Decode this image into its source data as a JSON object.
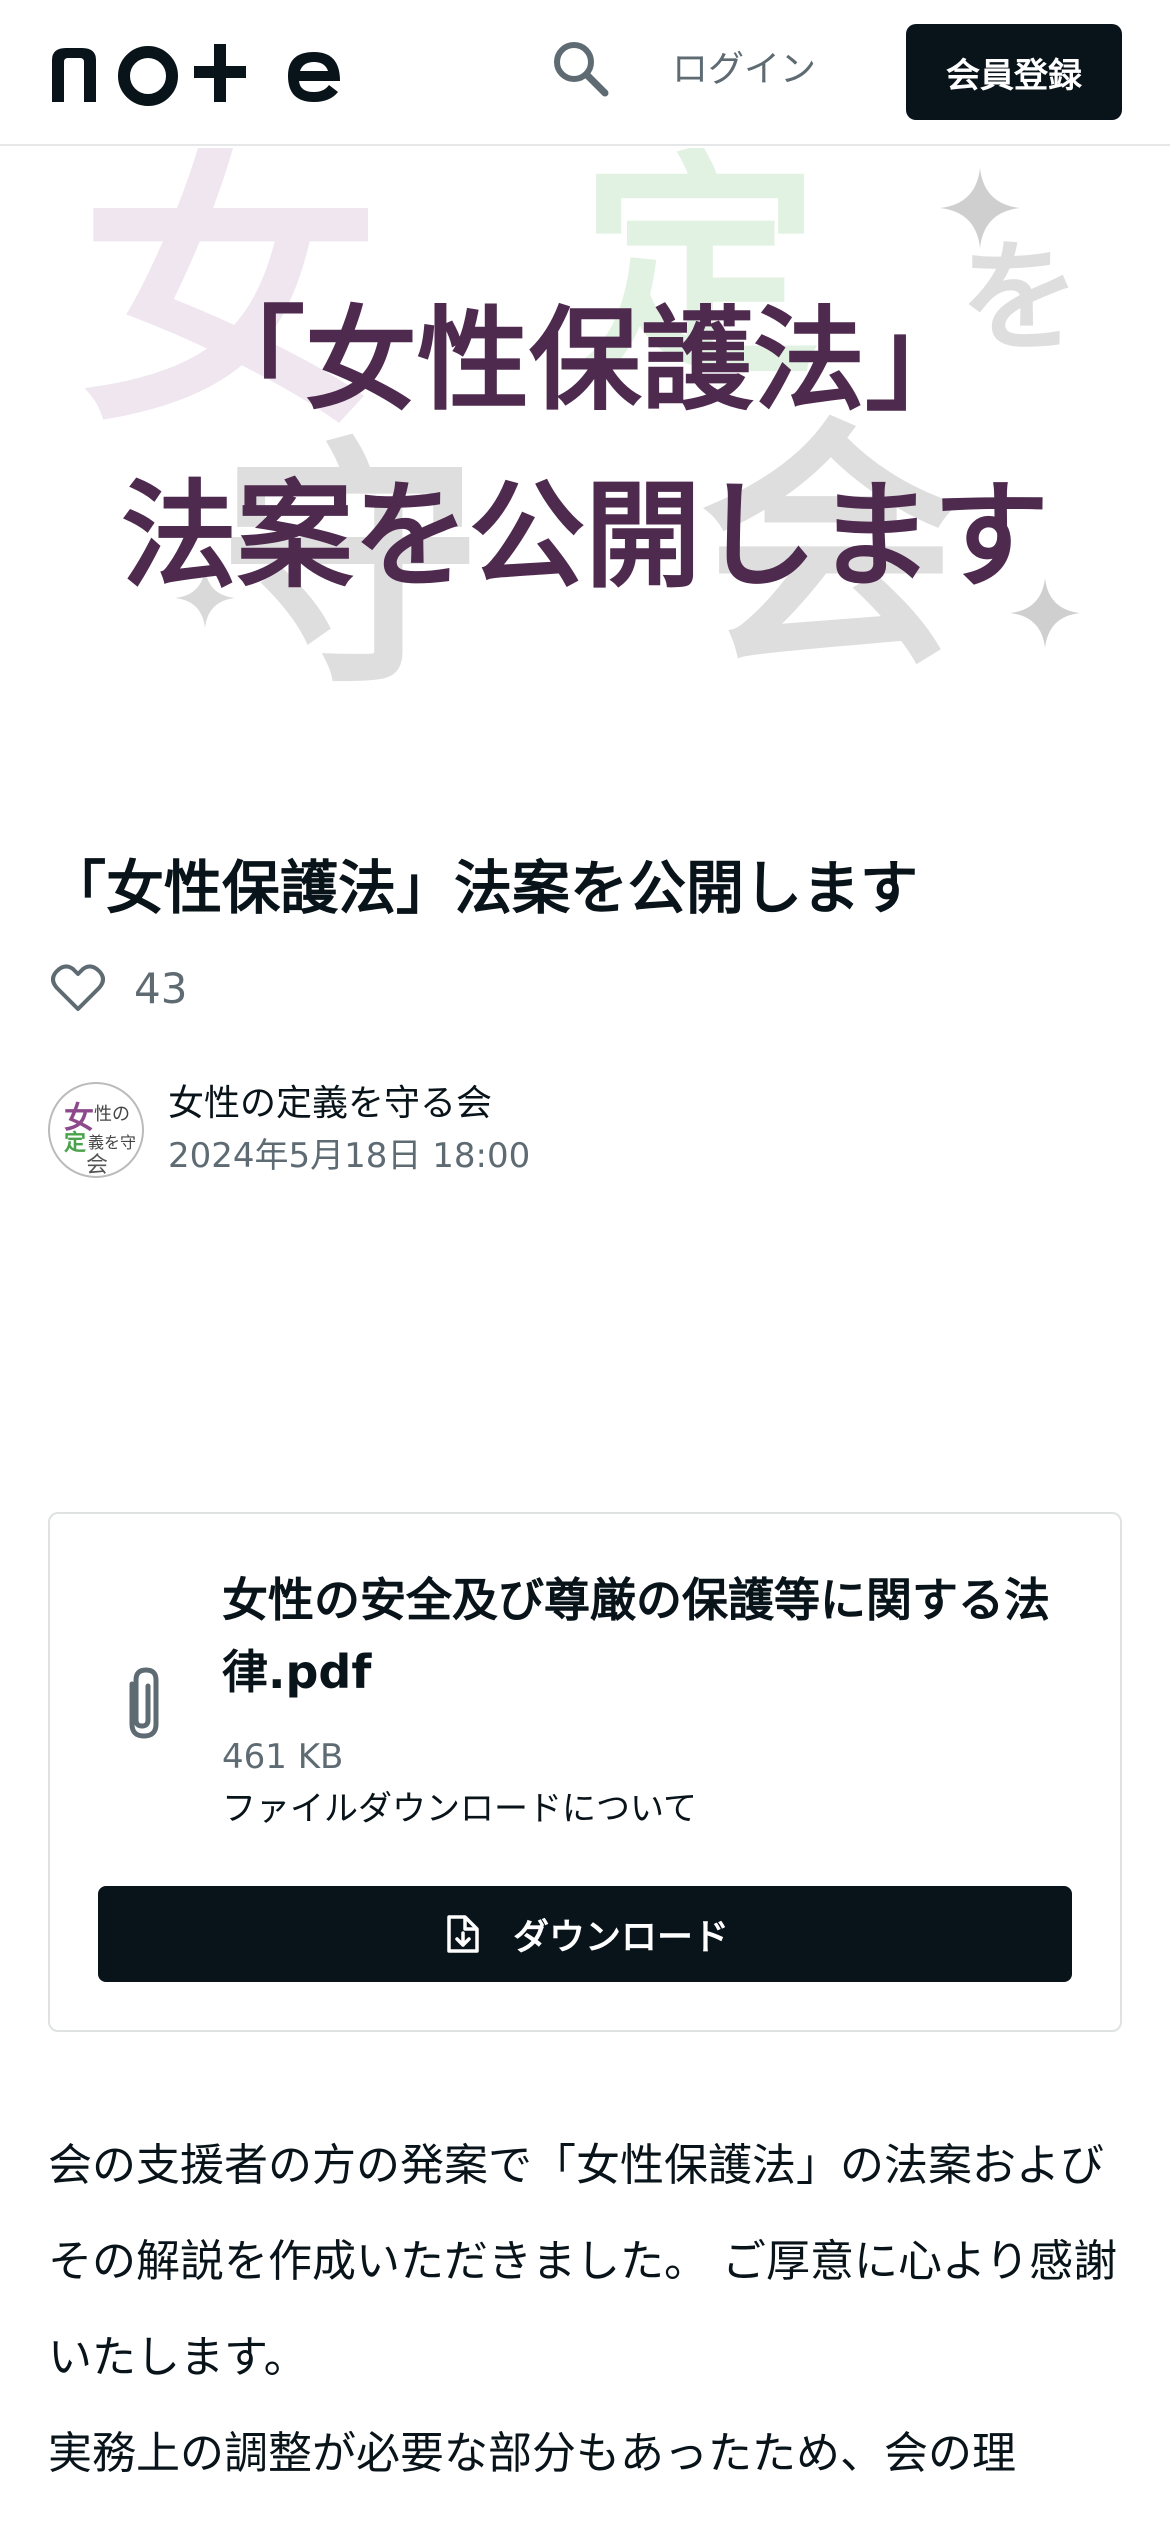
{
  "header": {
    "logo": "note",
    "search_icon": "search-icon",
    "login_label": "ログイン",
    "signup_label": "会員登録"
  },
  "hero": {
    "headline_line1": "「女性保護法」",
    "headline_line2": "法案を公開します",
    "bg_logo_text": "女性の定義を守る会",
    "colors": {
      "headline": "#4e2a4e",
      "accent_pink": "#c7a8c8",
      "accent_green": "#9bd39a",
      "gray": "#8a8a8a"
    }
  },
  "article": {
    "title": "「女性保護法」法案を公開します",
    "like_count": "43",
    "author_name": "女性の定義を守る会",
    "date": "2024年5月18日 18:00"
  },
  "file": {
    "name": "女性の安全及び尊厳の保護等に関する法律.pdf",
    "size": "461 KB",
    "about_link": "ファイルダウンロードについて",
    "download_label": "ダウンロード"
  },
  "body": {
    "paragraph1": "会の支援者の方の発案で「女性保護法」の法案およびその解説を作成いただきました。 ご厚意に心より感謝いたします。",
    "paragraph2": "実務上の調整が必要な部分もあったため、会の理"
  }
}
